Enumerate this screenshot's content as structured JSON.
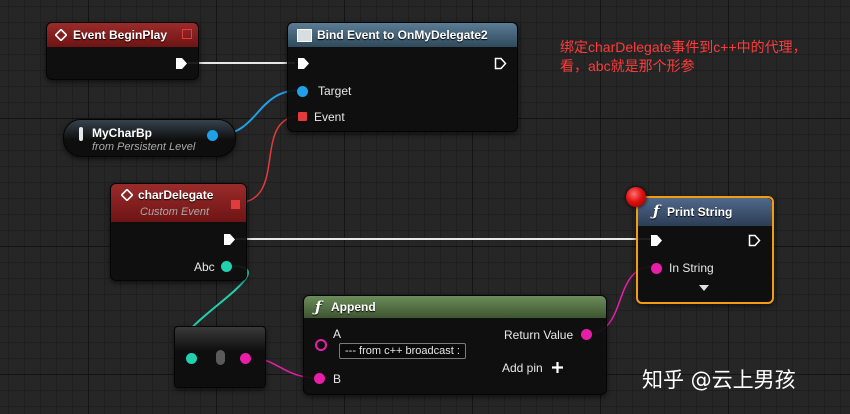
{
  "nodes": {
    "event_begin_play": {
      "title": "Event BeginPlay"
    },
    "bind_event": {
      "title": "Bind Event to OnMyDelegate2",
      "pins": {
        "target": "Target",
        "event": "Event"
      }
    },
    "my_char_bp": {
      "title": "MyCharBp",
      "subtitle": "from Persistent Level"
    },
    "char_delegate": {
      "title": "charDelegate",
      "subtitle": "Custom Event",
      "pins": {
        "abc": "Abc"
      }
    },
    "print_string": {
      "title": "Print String",
      "pins": {
        "in_string": "In String"
      }
    },
    "append": {
      "title": "Append",
      "pins": {
        "a": "A",
        "a_value": "--- from c++ broadcast :",
        "b": "B",
        "return_value": "Return Value",
        "add_pin": "Add pin"
      }
    }
  },
  "annotation": {
    "line1": "绑定charDelegate事件到c++中的代理，",
    "line2": "看，abc就是那个形参"
  },
  "watermark": "知乎 @云上男孩",
  "icons": {
    "event": "diamond-event-icon",
    "function": "function-f-icon",
    "variable": "variable-capsule-icon",
    "add": "plus-icon",
    "expand": "chevron-down-icon"
  },
  "colors": {
    "exec": "#ffffff",
    "object_pin": "#1fa0e8",
    "delegate_pin": "#e23b3b",
    "string_pin": "#e81ea8",
    "name_pin": "#22d0b0",
    "selection": "#f39c12",
    "annotation": "#ff3b3b"
  }
}
